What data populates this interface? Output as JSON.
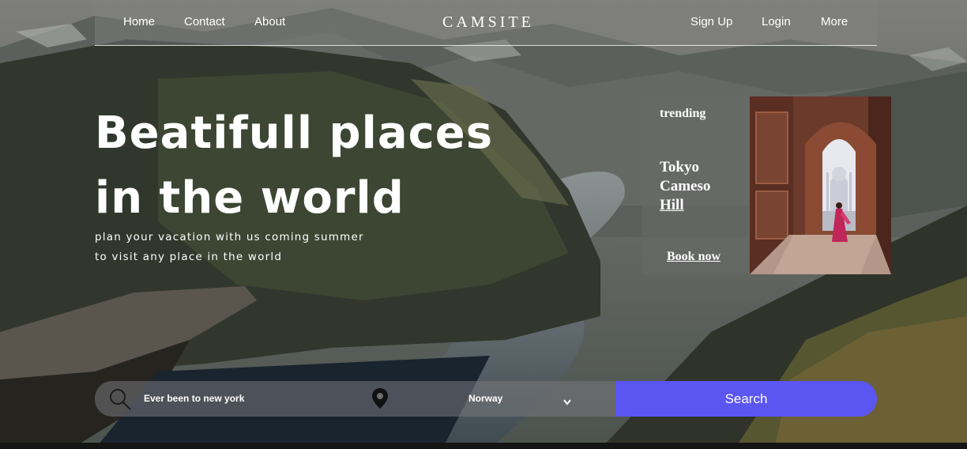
{
  "nav": {
    "left_links": [
      "Home",
      "Contact",
      "About"
    ],
    "brand": "CAMSITE",
    "right_links": [
      "Sign Up",
      "Login",
      "More"
    ]
  },
  "hero": {
    "title_line1": "Beatifull places",
    "title_line2": "in the world",
    "subtitle_line1": "plan your vacation with us coming summer",
    "subtitle_line2": "to visit any place in the world"
  },
  "trending": {
    "label": "trending",
    "place_line1": "Tokyo",
    "place_line2": "Cameso",
    "place_line3": "Hill",
    "cta": "Book now"
  },
  "search": {
    "query_value": "Ever been to new york",
    "location_selected": "Norway",
    "button_label": "Search",
    "search_icon": "search-icon",
    "location_icon": "location-pin-icon",
    "dropdown_icon": "chevron-down-icon"
  },
  "colors": {
    "accent": "#5b55f2",
    "nav_bg": "rgba(130,130,130,0.45)",
    "text": "#ffffff"
  }
}
